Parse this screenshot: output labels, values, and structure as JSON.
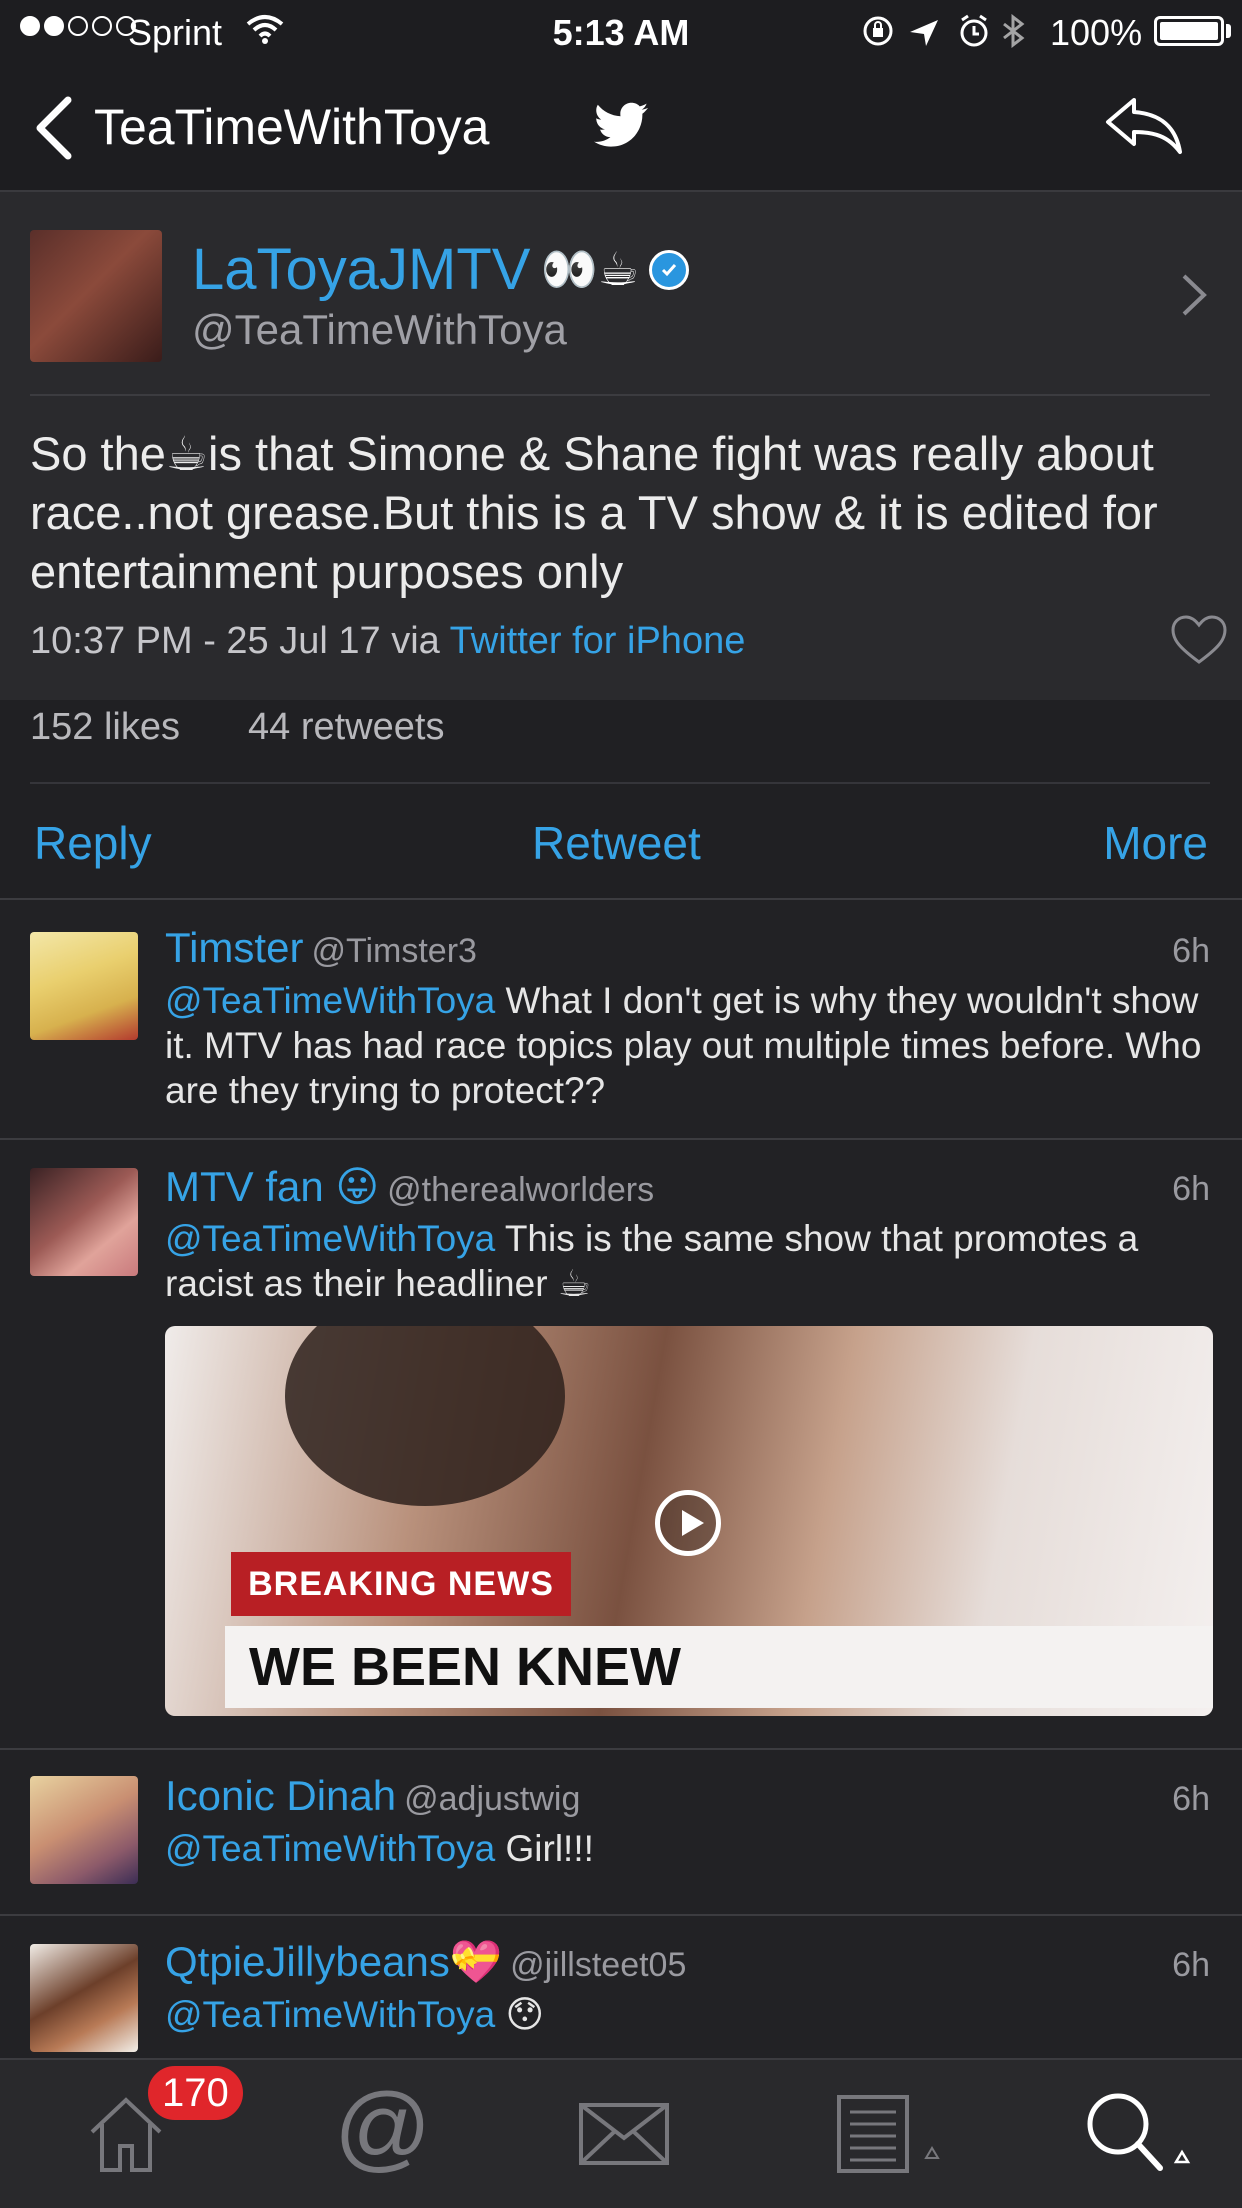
{
  "status_bar": {
    "carrier": "Sprint",
    "time": "5:13 AM",
    "battery": "100%"
  },
  "nav": {
    "back_label": "TeaTimeWithToya"
  },
  "tweet": {
    "display_name": "LaToyaJMTV",
    "name_emoji": "👀☕",
    "handle": "@TeaTimeWithToya",
    "text_before_emoji": "So the",
    "text_emoji": "☕",
    "text_after_emoji": "is that Simone & Shane fight was really about race..not grease.But this is a TV show & it is edited for entertainment purposes only",
    "timestamp": "10:37 PM - 25 Jul 17 via ",
    "source": "Twitter for iPhone",
    "likes": "152 likes",
    "retweets": "44 retweets"
  },
  "actions": {
    "reply": "Reply",
    "retweet": "Retweet",
    "more": "More"
  },
  "replies": [
    {
      "name": "Timster",
      "handle": "@Timster3",
      "time": "6h",
      "mention": "@TeaTimeWithToya",
      "text": " What I don't get is why they wouldn't show it. MTV has had race topics play out multiple times before. Who are they trying to protect??"
    },
    {
      "name": "MTV fan 😛",
      "handle": "@therealworlders",
      "time": "6h",
      "mention": "@TeaTimeWithToya",
      "text": " This is the same show that promotes a racist as their headliner ☕",
      "media": {
        "banner": "BREAKING NEWS",
        "caption": "WE BEEN KNEW"
      }
    },
    {
      "name": "Iconic Dinah",
      "handle": "@adjustwig",
      "time": "6h",
      "mention": "@TeaTimeWithToya",
      "text": " Girl!!!"
    },
    {
      "name": "QtpieJillybeans💝",
      "handle": "@jillsteet05",
      "time": "6h",
      "mention": "@TeaTimeWithToya",
      "text": " 😯"
    }
  ],
  "tabbar": {
    "home_badge": "170",
    "mentions_glyph": "@"
  },
  "colors": {
    "accent": "#36a3e6",
    "background": "#222225",
    "badge": "#e0262b"
  }
}
